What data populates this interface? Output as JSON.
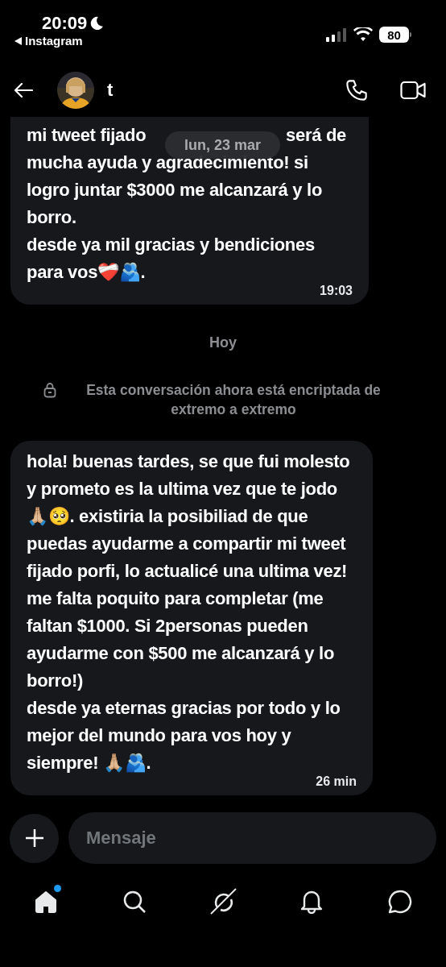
{
  "status_bar": {
    "time": "20:09",
    "back_app": "Instagram",
    "battery": "80"
  },
  "header": {
    "contact_name": "t"
  },
  "messages": [
    {
      "kind": "bubble",
      "text_before_pill": "mi tweet fijado",
      "text_after_pill": "será de",
      "text": "mucha ayuda y agradecimiento! si logro juntar $3000 me alcanzará y lo borro.\ndesde ya mil gracias y bendiciones para vos❤️‍🩹🫂.",
      "time": "19:03",
      "date_pill": "lun, 23 mar"
    },
    {
      "kind": "day",
      "text": "Hoy"
    },
    {
      "kind": "notice",
      "text": "Esta conversación ahora está encriptada de extremo a extremo"
    },
    {
      "kind": "bubble",
      "text": "hola! buenas tardes, se que fui molesto y prometo es la ultima vez que te jodo🙏🏼🥺. existiria la posibiliad de que puedas ayudarme a compartir mi tweet fijado porfi, lo actualicé una ultima vez! me falta poquito para completar (me faltan $1000. Si 2personas pueden ayudarme con $500 me alcanzará y lo borro!)\ndesde ya eternas gracias por todo y lo mejor del mundo para vos hoy y siempre! 🙏🏼🫂.",
      "time": "26 min"
    }
  ],
  "composer": {
    "placeholder": "Mensaje"
  },
  "nav": [
    {
      "kind": "home",
      "selected": true,
      "badge": true
    },
    {
      "kind": "search",
      "selected": false,
      "badge": false
    },
    {
      "kind": "grok",
      "selected": false,
      "badge": false
    },
    {
      "kind": "bell",
      "selected": false,
      "badge": false
    },
    {
      "kind": "chat",
      "selected": false,
      "badge": false
    }
  ]
}
